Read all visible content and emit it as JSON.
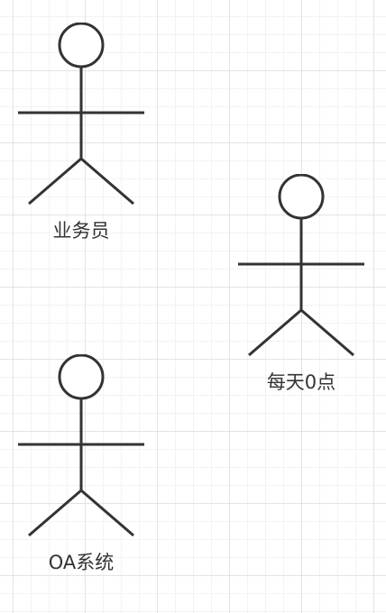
{
  "diagram": {
    "actors": [
      {
        "id": "salesperson",
        "label": "业务员"
      },
      {
        "id": "daily-midnight",
        "label": "每天0点"
      },
      {
        "id": "oa-system",
        "label": "OA系统"
      }
    ]
  }
}
